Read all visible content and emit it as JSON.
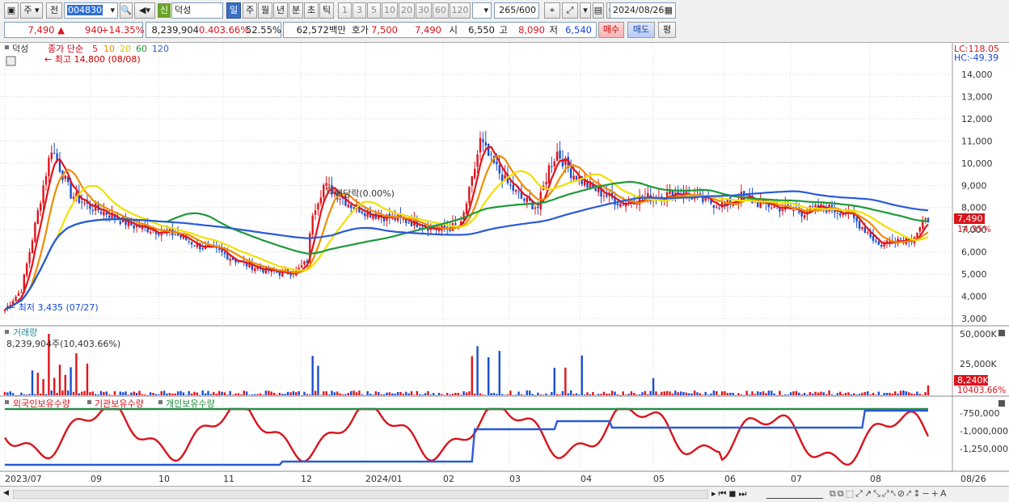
{
  "toolbar": {
    "market": "주",
    "prev": "전",
    "code": "004830",
    "stock_badge": "신",
    "stock_name": "덕성",
    "period_tabs": [
      "일",
      "주",
      "월",
      "년",
      "분",
      "초",
      "틱"
    ],
    "active_period": "일",
    "interval_buttons": [
      "1",
      "3",
      "5",
      "10",
      "20",
      "30",
      "60",
      "120"
    ],
    "view_count": "265",
    "view_total": "/600",
    "date": "2024/08/26"
  },
  "quote": {
    "price": "7,490",
    "change_arrow": "▲",
    "change": "940",
    "change_pct": "+14.35%",
    "volume": "8,239,904",
    "volume_ratio": "0.403.66%",
    "turnover_pct": "52.55%",
    "amount": "62,572백만",
    "ask_label": "호가",
    "ask": "7,500",
    "bid": "7,490",
    "open_label": "시",
    "open": "6,550",
    "high_label": "고",
    "high": "8,090",
    "low_label": "저",
    "low": "6,540",
    "buy_label": "매수",
    "sell_label": "매도",
    "eval_label": "평"
  },
  "price_panel": {
    "stock_tag": "덕성",
    "legend_prefix": "종가 단순",
    "ma_periods": [
      "5",
      "10",
      "20",
      "60",
      "120"
    ],
    "ma_colors": [
      "#e0141c",
      "#f08c00",
      "#f0e000",
      "#1e9a3a",
      "#2a5ad8"
    ],
    "lc": "LC:118.05",
    "hc": "HC:-49.39",
    "max_label": "최고 14,800 (08/08)",
    "min_label": "최저 3,435 (07/27)",
    "dividend_label": "배당락(0.00%)",
    "last_price_tag": "7,490",
    "last_pct_tag": "14.35%",
    "y_ticks": [
      "14,000",
      "13,000",
      "12,000",
      "11,000",
      "10,000",
      "9,000",
      "8,000",
      "7,000",
      "6,000",
      "5,000",
      "4,000",
      "3,000"
    ]
  },
  "volume_panel": {
    "title": "거래량",
    "value": "8,239,904주(10,403.66%)",
    "y_ticks": [
      "50,000K",
      "25,000K"
    ],
    "last_tag": "8,240K",
    "pct_tag": "10403.66%"
  },
  "holdings_panel": {
    "labels": [
      "외국인보유수량",
      "기관보유수량",
      "개인보유수량"
    ],
    "colors": [
      "#d8141c",
      "#d8141c",
      "#1e8a3a"
    ],
    "y_ticks": [
      "-750,000",
      "-1,000,000",
      "-1,250,000"
    ]
  },
  "x_axis": [
    "2023/07",
    "09",
    "10",
    "11",
    "12",
    "2024/01",
    "02",
    "03",
    "04",
    "05",
    "06",
    "07",
    "08",
    "08/26"
  ]
}
